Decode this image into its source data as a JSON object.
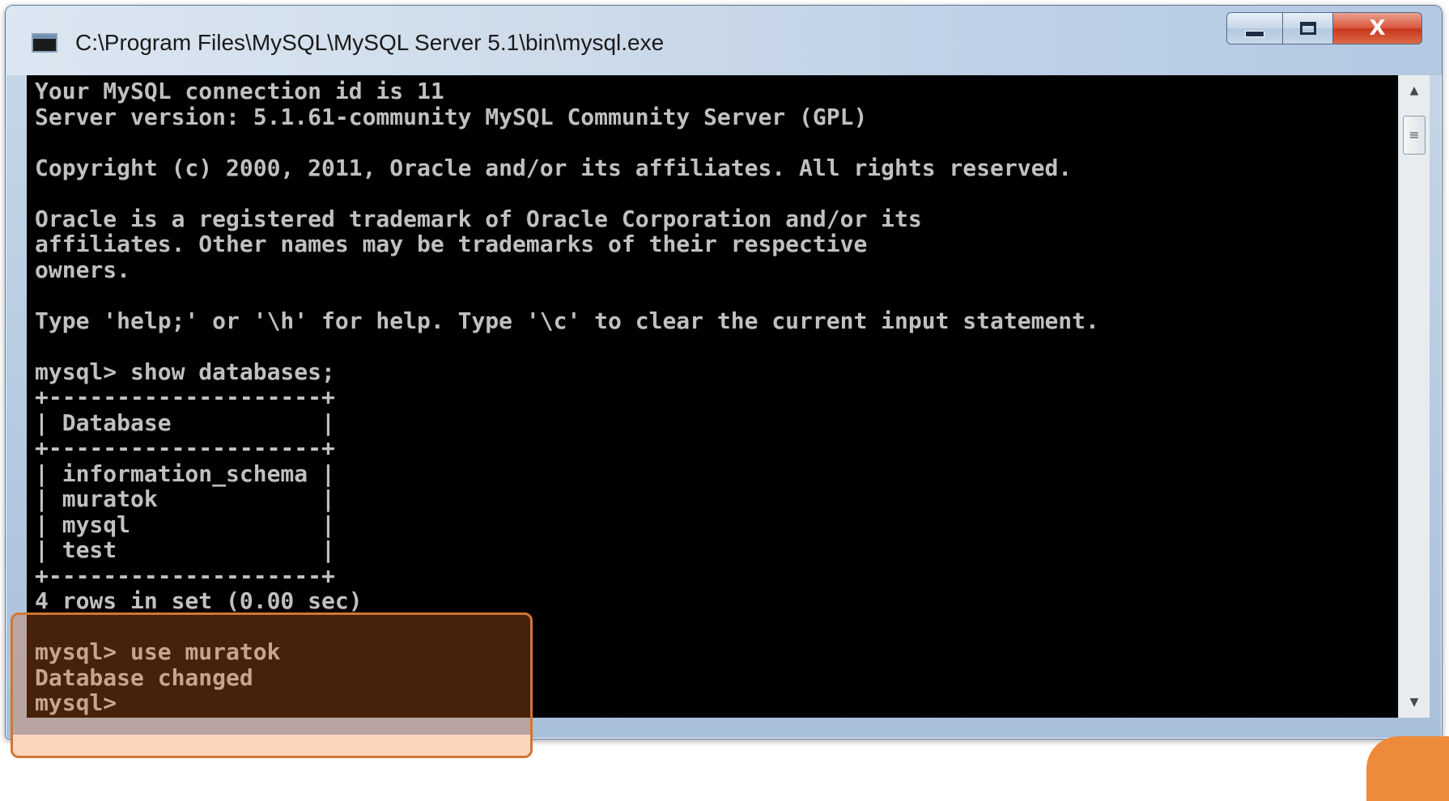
{
  "window": {
    "title": "C:\\Program Files\\MySQL\\MySQL Server 5.1\\bin\\mysql.exe",
    "buttons": {
      "minimize": "—",
      "maximize": "□",
      "close": "X"
    }
  },
  "console": {
    "text_color": "#c0c0c0",
    "background": "#000000",
    "lines": [
      "Your MySQL connection id is 11",
      "Server version: 5.1.61-community MySQL Community Server (GPL)",
      "",
      "Copyright (c) 2000, 2011, Oracle and/or its affiliates. All rights reserved.",
      "",
      "Oracle is a registered trademark of Oracle Corporation and/or its",
      "affiliates. Other names may be trademarks of their respective",
      "owners.",
      "",
      "Type 'help;' or '\\h' for help. Type '\\c' to clear the current input statement.",
      "",
      "mysql> show databases;",
      "+--------------------+",
      "| Database           |",
      "+--------------------+",
      "| information_schema |",
      "| muratok            |",
      "| mysql              |",
      "| test               |",
      "+--------------------+",
      "4 rows in set (0.00 sec)",
      "",
      "mysql> use muratok",
      "Database changed",
      "mysql>"
    ]
  },
  "highlight": {
    "color": "#d07734"
  },
  "scrollbar": {
    "up_arrow": "▲",
    "down_arrow": "▼",
    "thumb_grip": "≡"
  }
}
